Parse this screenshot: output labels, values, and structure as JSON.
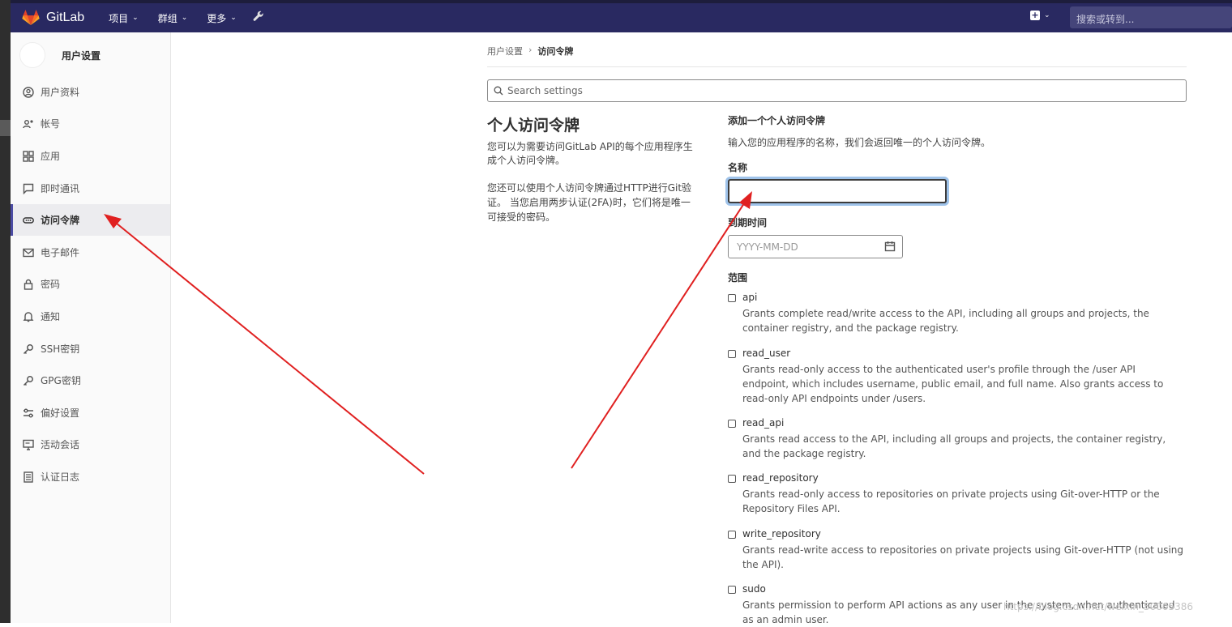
{
  "topbar": {
    "brand": "GitLab",
    "nav": [
      {
        "label": "项目"
      },
      {
        "label": "群组"
      },
      {
        "label": "更多"
      }
    ],
    "search_placeholder": "搜索或转到..."
  },
  "sidebar": {
    "title": "用户设置",
    "items": [
      {
        "label": "用户资料",
        "icon": "profile-icon"
      },
      {
        "label": "帐号",
        "icon": "account-icon"
      },
      {
        "label": "应用",
        "icon": "applications-icon"
      },
      {
        "label": "即时通讯",
        "icon": "chat-icon"
      },
      {
        "label": "访问令牌",
        "icon": "token-icon",
        "active": true
      },
      {
        "label": "电子邮件",
        "icon": "mail-icon"
      },
      {
        "label": "密码",
        "icon": "lock-icon"
      },
      {
        "label": "通知",
        "icon": "bell-icon"
      },
      {
        "label": "SSH密钥",
        "icon": "key-icon"
      },
      {
        "label": "GPG密钥",
        "icon": "key-icon"
      },
      {
        "label": "偏好设置",
        "icon": "preferences-icon"
      },
      {
        "label": "活动会话",
        "icon": "monitor-icon"
      },
      {
        "label": "认证日志",
        "icon": "log-icon"
      }
    ]
  },
  "breadcrumb": {
    "parent": "用户设置",
    "current": "访问令牌"
  },
  "search": {
    "placeholder": "Search settings"
  },
  "section": {
    "title": "个人访问令牌",
    "desc1": "您可以为需要访问GitLab API的每个应用程序生成个人访问令牌。",
    "desc2": "您还可以使用个人访问令牌通过HTTP进行Git验证。 当您启用两步认证(2FA)时，它们将是唯一可接受的密码。"
  },
  "form": {
    "heading": "添加一个个人访问令牌",
    "subheading": "输入您的应用程序的名称，我们会返回唯一的个人访问令牌。",
    "name_label": "名称",
    "name_value": "",
    "expires_label": "到期时间",
    "expires_placeholder": "YYYY-MM-DD",
    "scopes_label": "范围",
    "scopes": [
      {
        "name": "api",
        "desc": "Grants complete read/write access to the API, including all groups and projects, the container registry, and the package registry.",
        "checked": false
      },
      {
        "name": "read_user",
        "desc": "Grants read-only access to the authenticated user's profile through the /user API endpoint, which includes username, public email, and full name. Also grants access to read-only API endpoints under /users.",
        "checked": false
      },
      {
        "name": "read_api",
        "desc": "Grants read access to the API, including all groups and projects, the container registry, and the package registry.",
        "checked": false
      },
      {
        "name": "read_repository",
        "desc": "Grants read-only access to repositories on private projects using Git-over-HTTP or the Repository Files API.",
        "checked": false
      },
      {
        "name": "write_repository",
        "desc": "Grants read-write access to repositories on private projects using Git-over-HTTP (not using the API).",
        "checked": false
      },
      {
        "name": "sudo",
        "desc": "Grants permission to perform API actions as any user in the system, when authenticated as an admin user.",
        "checked": false
      }
    ]
  },
  "annotation": {
    "arrow_color": "#e02020"
  },
  "watermark": "https://blog.csdn.net/weixin_50005386"
}
